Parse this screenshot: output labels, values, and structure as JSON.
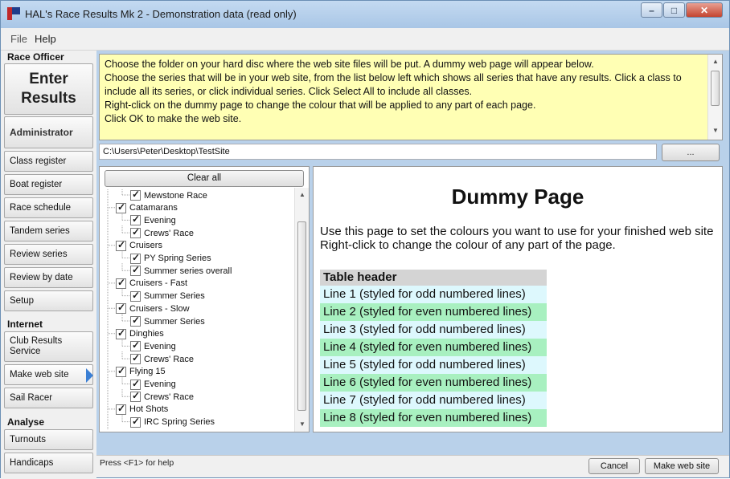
{
  "window": {
    "title": "HAL's Race Results Mk 2 - Demonstration data (read only)",
    "buttons": {
      "minimize": "–",
      "maximize": "□",
      "close": "✕"
    }
  },
  "menu": {
    "file": "File",
    "help": "Help"
  },
  "sidebar": {
    "race_officer_label": "Race Officer",
    "enter_results": [
      "Enter",
      "Results"
    ],
    "administrator": "Administrator",
    "admin_items": [
      "Class register",
      "Boat register",
      "Race schedule",
      "Tandem series",
      "Review series",
      "Review by date",
      "Setup"
    ],
    "internet_label": "Internet",
    "internet_items": [
      "Club Results Service",
      "Make web site",
      "Sail Racer"
    ],
    "analyse_label": "Analyse",
    "analyse_items": [
      "Turnouts",
      "Handicaps"
    ]
  },
  "info": {
    "lines": [
      "Choose the folder on your hard disc where the web site files will be put.  A dummy web page will appear below.",
      "Choose the series that will be in your web site, from the list below left which shows all series that have any results. Click a class to include all its series, or click individual series. Click Select All to include all classes.",
      "Right-click on the dummy page to change the colour that will be applied to any part of each page.",
      "Click OK to make the web site."
    ]
  },
  "path": {
    "value": "C:\\Users\\Peter\\Desktop\\TestSite",
    "browse_label": "..."
  },
  "tree": {
    "clear_label": "Clear all",
    "nodes": [
      {
        "label": "Mewstone Race",
        "level": 1
      },
      {
        "label": "Catamarans",
        "level": 0
      },
      {
        "label": "Evening",
        "level": 1
      },
      {
        "label": "Crews' Race",
        "level": 1
      },
      {
        "label": "Cruisers",
        "level": 0
      },
      {
        "label": "PY Spring Series",
        "level": 1
      },
      {
        "label": "Summer series overall",
        "level": 1
      },
      {
        "label": "Cruisers - Fast",
        "level": 0
      },
      {
        "label": "Summer Series",
        "level": 1
      },
      {
        "label": "Cruisers - Slow",
        "level": 0
      },
      {
        "label": "Summer Series",
        "level": 1
      },
      {
        "label": "Dinghies",
        "level": 0
      },
      {
        "label": "Evening",
        "level": 1
      },
      {
        "label": "Crews' Race",
        "level": 1
      },
      {
        "label": "Flying 15",
        "level": 0
      },
      {
        "label": "Evening",
        "level": 1
      },
      {
        "label": "Crews' Race",
        "level": 1
      },
      {
        "label": "Hot Shots",
        "level": 0
      },
      {
        "label": "IRC Spring Series",
        "level": 1
      }
    ]
  },
  "dummy": {
    "title": "Dummy Page",
    "body1": "Use this page to set the colours you want to use for your finished web site",
    "body2": "Right-click to change the colour of any part of the page.",
    "table_header": "Table header",
    "lines": [
      "Line 1 (styled for odd numbered lines)",
      "Line 2 (styled for even numbered lines)",
      "Line 3 (styled for odd numbered lines)",
      "Line 4 (styled for even numbered lines)",
      "Line 5 (styled for odd numbered lines)",
      "Line 6 (styled for even numbered lines)",
      "Line 7 (styled for odd numbered lines)",
      "Line 8 (styled for even numbered lines)"
    ],
    "colors": {
      "header": "#d4d4d4",
      "odd": "#ddf8fd",
      "even": "#a8f0c0"
    }
  },
  "status": {
    "text": "Press <F1> for help",
    "cancel_label": "Cancel",
    "make_label": "Make web site"
  }
}
